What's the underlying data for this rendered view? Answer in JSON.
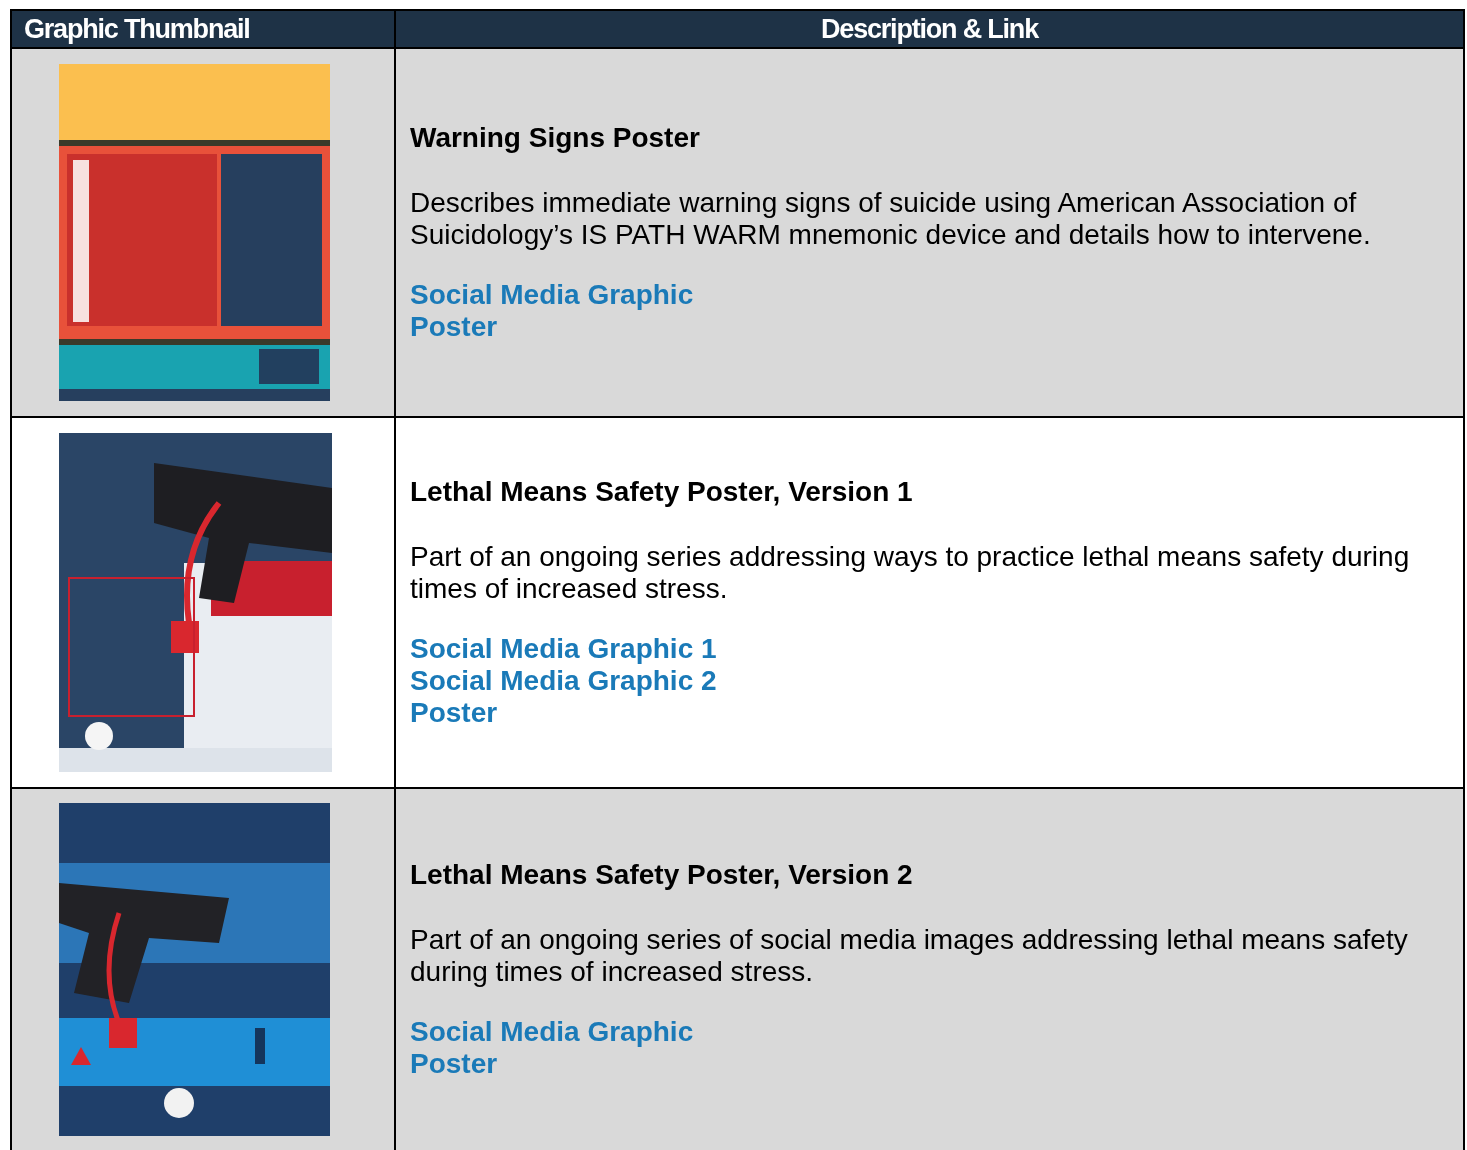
{
  "table": {
    "columns": [
      "Graphic Thumbnail",
      "Description & Link"
    ],
    "rows": [
      {
        "shaded": true,
        "thumbnail": {
          "kind": "picture"
        },
        "title": "Warning Signs Poster",
        "description": "Describes immediate warning signs of suicide using American Association of Suicidology’s IS PATH WARM mnemonic device and details how to intervene.",
        "links": [
          "Social Media Graphic",
          "Poster"
        ]
      },
      {
        "shaded": false,
        "thumbnail": {
          "kind": "picture"
        },
        "title": "Lethal Means Safety Poster, Version 1",
        "description": "Part of an ongoing series addressing ways to practice lethal means safety during times of increased stress.",
        "links": [
          "Social Media Graphic 1",
          "Social Media Graphic 2",
          "Poster"
        ]
      },
      {
        "shaded": true,
        "thumbnail": {
          "kind": "picture"
        },
        "title": "Lethal Means Safety Poster, Version 2",
        "description": "Part of an ongoing series of social media images addressing lethal means safety during times of increased stress.",
        "links": [
          "Social Media Graphic",
          "Poster"
        ]
      }
    ]
  }
}
